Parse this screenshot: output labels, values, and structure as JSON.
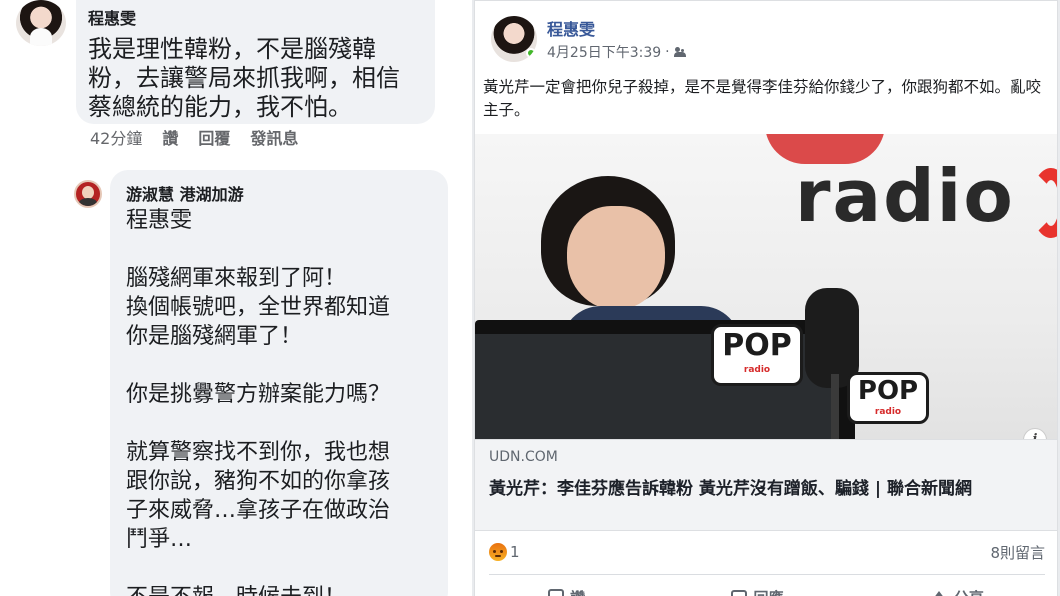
{
  "comment1": {
    "author": "程惠雯",
    "lines": [
      "我是理性韓粉，不是腦殘韓",
      "粉，去讓警局來抓我啊，相信",
      "蔡總統的能力，我不怕。"
    ],
    "time": "42分鐘",
    "actions": [
      "讚",
      "回覆",
      "發訊息"
    ]
  },
  "reply": {
    "author": "游淑慧 港湖加游",
    "lines": [
      "程惠雯",
      "",
      " 腦殘網軍來報到了阿！",
      "換個帳號吧，全世界都知道",
      "你是腦殘網軍了！",
      "",
      "你是挑釁警方辦案能力嗎？",
      "",
      "就算警察找不到你，我也想",
      "跟你說，豬狗不如的你拿孩",
      "子來威脅…拿孩子在做政治",
      "鬥爭…",
      "",
      "不是不報，時候未到！"
    ]
  },
  "post": {
    "author": "程惠雯",
    "date": "4月25日下午3:39",
    "audience_icon": "friends-icon",
    "text": "黃光芹一定會把你兒子殺掉，是不是覺得李佳芬給你錢少了，你跟狗都不如。亂咬主子。",
    "photo": {
      "logo": "radio",
      "badge1": "POP",
      "badge1_sub": "radio",
      "badge2": "POP",
      "badge2_sub": "radio"
    },
    "link": {
      "domain": "UDN.COM",
      "title": "黃光芹：李佳芬應告訴韓粉 黃光芹沒有蹭飯、騙錢 | 聯合新聞網"
    },
    "reaction_count": "1",
    "comment_count": "8則留言",
    "actions": [
      "讚",
      "回應",
      "分享"
    ]
  },
  "colors": {
    "name_link": "#385898",
    "bubble_bg": "#f0f2f5",
    "online": "#42b72a",
    "angry_reaction": "#e9710f"
  }
}
